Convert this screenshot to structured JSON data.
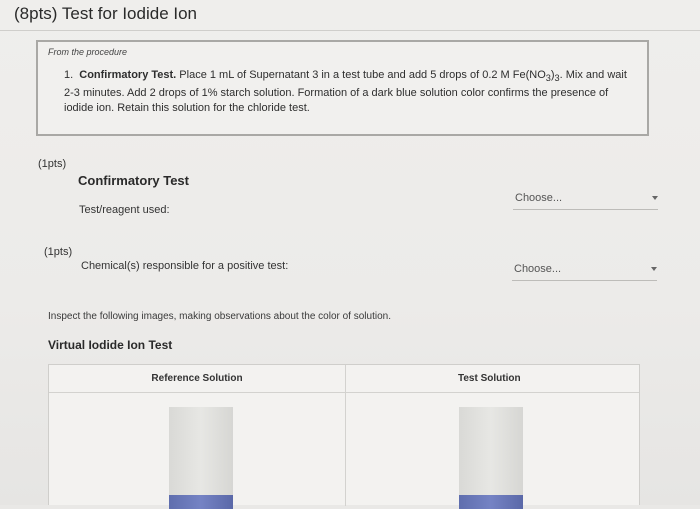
{
  "header": {
    "title": "(8pts) Test for Iodide Ion"
  },
  "procedure": {
    "label": "From the procedure",
    "step_number": "1.",
    "step_title": "Confirmatory Test.",
    "step_text_a": "Place 1 mL of Supernatant 3 in a test tube and add 5 drops of 0.2 M Fe(NO",
    "step_sub_a": "3",
    "step_text_b": ")",
    "step_sub_b": "3",
    "step_text_c": ". Mix and wait 2-3 minutes. Add 2 drops of 1% starch solution. Formation of a dark blue solution color confirms the presence of iodide ion. Retain this solution for the chloride test."
  },
  "questions": [
    {
      "points": "(1pts)",
      "heading": "Confirmatory Test",
      "label": "Test/reagent used:",
      "select_value": "Choose..."
    },
    {
      "points": "(1pts)",
      "label": "Chemical(s) responsible for a positive test:",
      "select_value": "Choose..."
    }
  ],
  "instruction": "Inspect the following images, making observations about the color of solution.",
  "virtual_test": {
    "title": "Virtual Iodide Ion Test",
    "columns": [
      "Reference Solution",
      "Test Solution"
    ]
  },
  "colors": {
    "background": "#ecebe9",
    "liquid": "#6b79ba"
  }
}
